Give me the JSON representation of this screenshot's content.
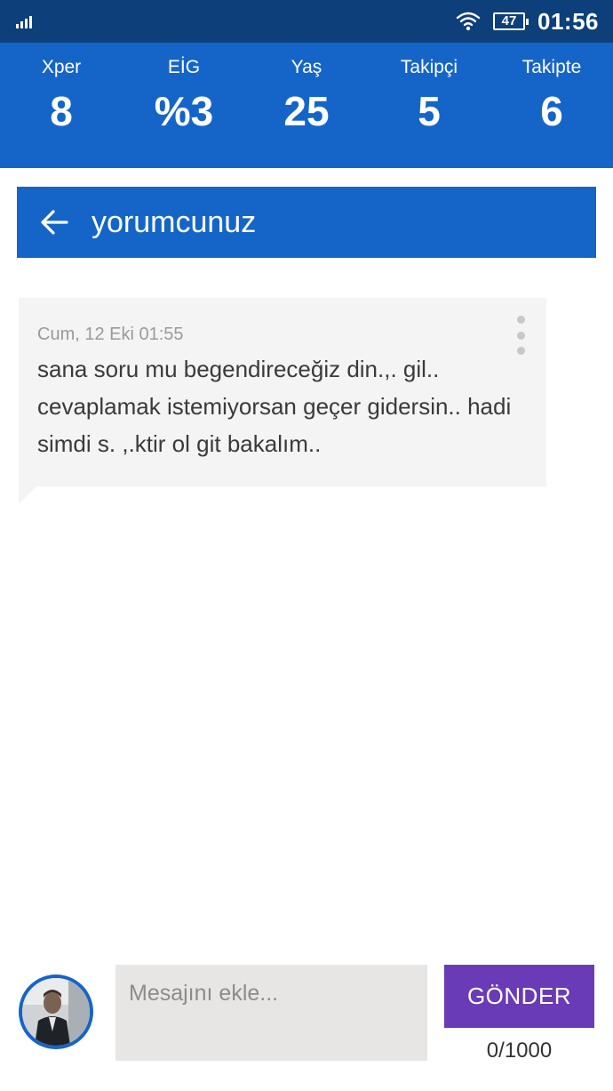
{
  "status_bar": {
    "battery": "47",
    "time": "01:56"
  },
  "stats": [
    {
      "label": "Xper",
      "value": "8"
    },
    {
      "label": "EİG",
      "value": "%3"
    },
    {
      "label": "Yaş",
      "value": "25"
    },
    {
      "label": "Takipçi",
      "value": "5"
    },
    {
      "label": "Takipte",
      "value": "6"
    }
  ],
  "header": {
    "title": "yorumcunuz"
  },
  "message": {
    "time": "Cum, 12 Eki 01:55",
    "text": "sana soru mu begendireceğiz din.,. gil.. cevaplamak istemiyorsan geçer gidersin.. hadi simdi s. ,.ktir ol git bakalım.."
  },
  "composer": {
    "placeholder": "Mesajını ekle...",
    "value": "",
    "send_label": "GÖNDER",
    "counter": "0/1000"
  },
  "icons": {
    "back": "arrow-left-icon",
    "more": "more-vertical-icon",
    "wifi": "wifi-icon",
    "signal": "signal-icon",
    "battery": "battery-icon"
  },
  "colors": {
    "status_bar": "#0d3f7a",
    "primary": "#1565c9",
    "send_button": "#6a3bb7",
    "bubble": "#f4f4f4",
    "input": "#e7e6e4"
  }
}
